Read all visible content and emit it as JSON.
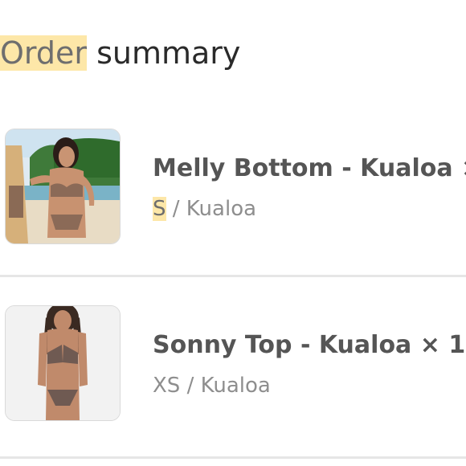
{
  "summary": {
    "title_highlight": "Order",
    "title_rest": " summary"
  },
  "items": [
    {
      "name": "Melly Bottom - Kualoa ×",
      "size": "S",
      "variant_rest": " / Kualoa"
    },
    {
      "name": "Sonny Top - Kualoa × 1",
      "size": "XS",
      "variant_rest": " / Kualoa"
    }
  ],
  "colors": {
    "highlight": "#fde7a8",
    "text_dark": "#2a2a2a",
    "text_muted": "#8e8e8e",
    "divider": "#e6e6e6"
  }
}
